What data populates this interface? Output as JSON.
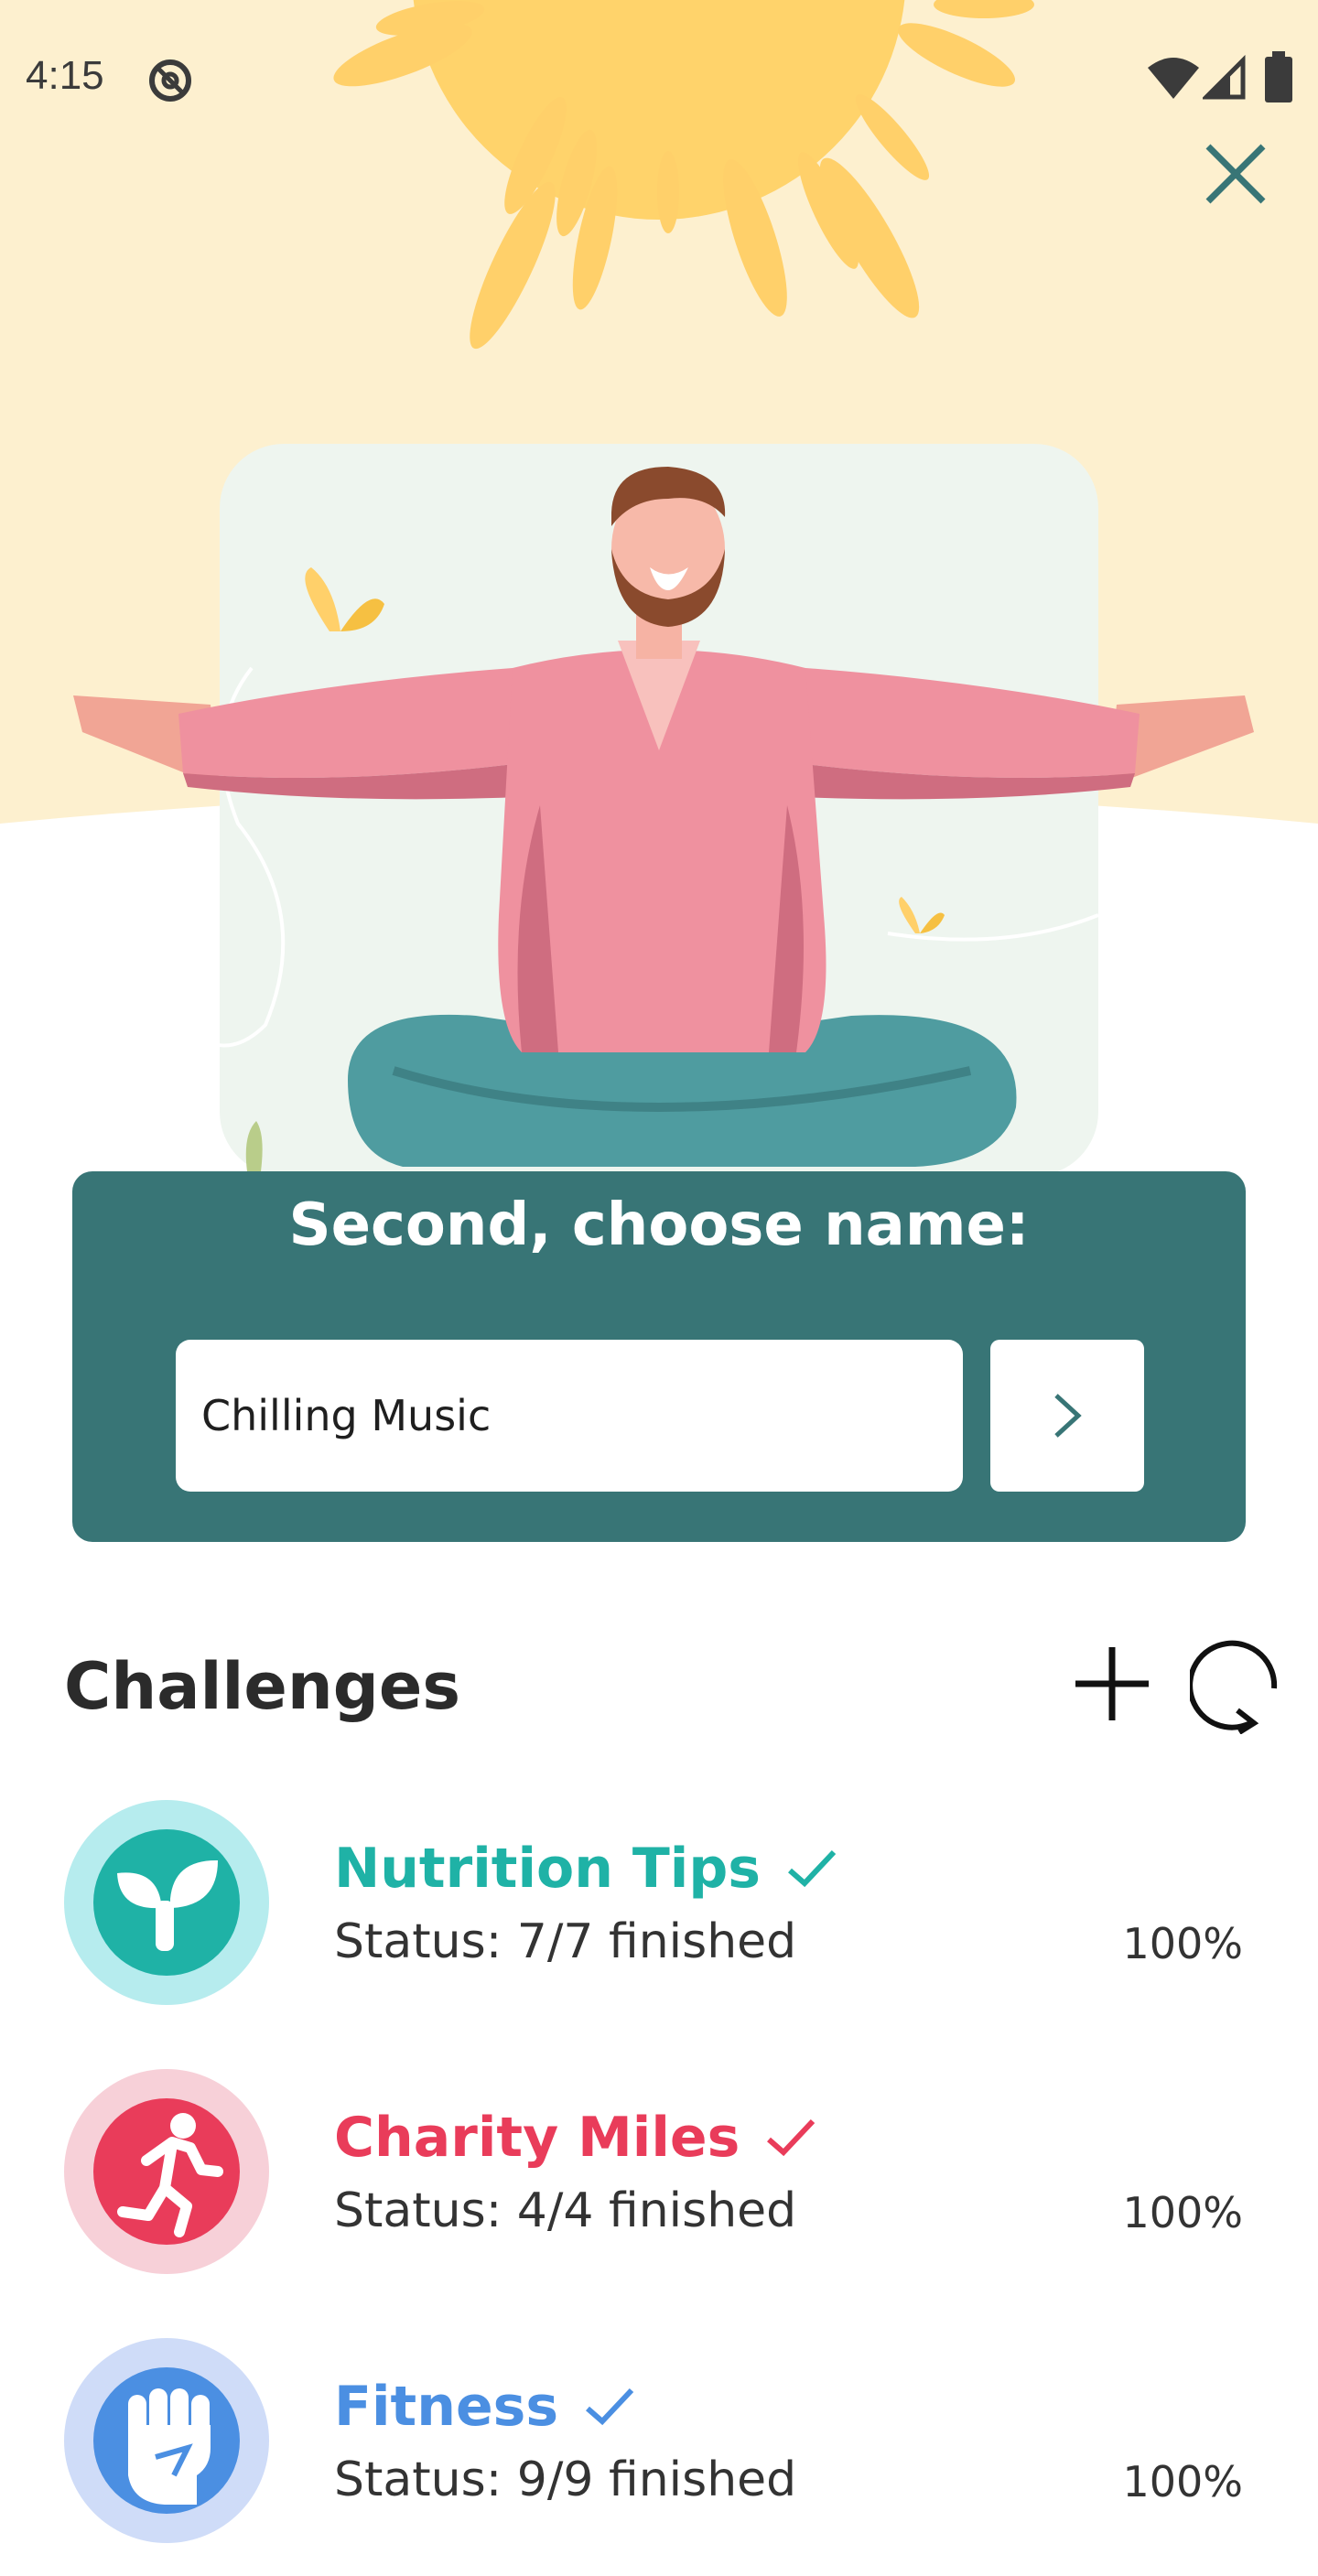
{
  "status_bar": {
    "time": "4:15"
  },
  "colors": {
    "hero_bg": "#fdf0cf",
    "sun": "#ffd36b",
    "panel": "#387576",
    "nutrition": "#1fb2a6",
    "nutrition_ring": "#b6ecee",
    "charity": "#e93c5a",
    "charity_ring": "#f7d0d8",
    "fitness": "#4b8fe2",
    "fitness_ring": "#cfdcf8"
  },
  "name_panel": {
    "title": "Second, choose name:",
    "input_value": "Chilling Music",
    "next_icon": "chevron-right-icon"
  },
  "challenges": {
    "title": "Challenges",
    "items": [
      {
        "name": "Nutrition Tips",
        "status": "Status: 7/7 finished",
        "percent": "100%",
        "icon": "sprout-icon"
      },
      {
        "name": "Charity Miles",
        "status": "Status: 4/4 finished",
        "percent": "100%",
        "icon": "runner-icon"
      },
      {
        "name": "Fitness",
        "status": "Status: 9/9 finished",
        "percent": "100%",
        "icon": "fist-icon"
      }
    ]
  }
}
